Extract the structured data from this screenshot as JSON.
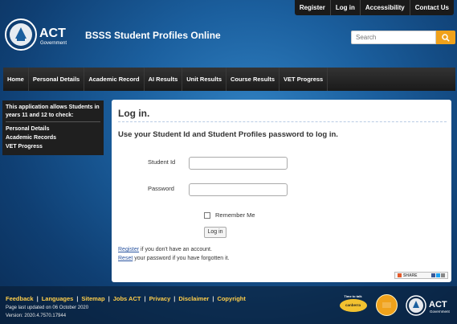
{
  "top_nav": [
    "Register",
    "Log in",
    "Accessibility",
    "Contact Us"
  ],
  "logo": {
    "name": "ACT",
    "sub": "Government"
  },
  "site_title": "BSSS Student Profiles Online",
  "search": {
    "placeholder": "Search"
  },
  "main_nav": [
    "Home",
    "Personal Details",
    "Academic Record",
    "AI Results",
    "Unit Results",
    "Course Results",
    "VET Progress"
  ],
  "sidebar": {
    "intro": "This application allows Students in years 11 and 12 to check:",
    "links": [
      "Personal Details",
      "Academic Records",
      "VET Progress"
    ]
  },
  "login": {
    "title": "Log in.",
    "subtitle": "Use your Student Id and Student Profiles password to log in.",
    "student_id_label": "Student Id",
    "password_label": "Password",
    "remember_label": "Remember Me",
    "button_label": "Log in",
    "register_link": "Register",
    "register_text": " if you don't have an account.",
    "reset_link": "Reset",
    "reset_text": " your password if you have forgotten it."
  },
  "share": {
    "label": "SHARE"
  },
  "footer": {
    "links": [
      "Feedback",
      "Languages",
      "Sitemap",
      "Jobs ACT",
      "Privacy",
      "Disclaimer",
      "Copyright"
    ],
    "updated": "Page last updated on 06 October 2020",
    "version": "Version: 2020.4.7570.17944",
    "badge1_top": "Time to talk",
    "badge1_text": "canberra",
    "logo_name": "ACT",
    "logo_sub": "Government"
  },
  "colors": {
    "accent": "#f0a21b",
    "link": "#2b55a0",
    "footer_link": "#ffce4a"
  }
}
